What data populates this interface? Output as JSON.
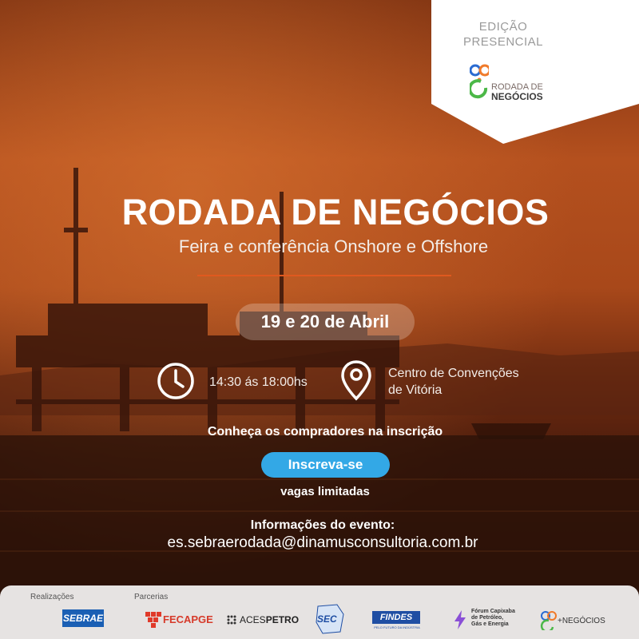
{
  "badge": {
    "line1": "EDIÇÃO",
    "line2": "PRESENCIAL",
    "logo_line1": "RODADA DE",
    "logo_line2": "NEGÓCIOS"
  },
  "hero": {
    "title": "RODADA DE NEGÓCIOS",
    "subtitle": "Feira e conferência Onshore e Offshore"
  },
  "event": {
    "date": "19 e 20 de Abril",
    "time": "14:30 ás 18:00hs",
    "place_line1": "Centro de Convenções",
    "place_line2": "de Vitória"
  },
  "cta": {
    "buyers": "Conheça os compradores na inscrição",
    "button": "Inscreva-se",
    "limited": "vagas limitadas"
  },
  "info": {
    "label": "Informações do evento:",
    "email": "es.sebraerodada@dinamusconsultoria.com.br"
  },
  "footer": {
    "realizacoes": "Realizações",
    "parcerias": "Parcerias",
    "logos": {
      "sebrae": "SEBRAE",
      "fecapge": "FECAPGE",
      "acespetro_a": "ACES",
      "acespetro_b": "PETRO",
      "sec": "SEC",
      "findes": "FINDES",
      "findes_sub": "PELO FUTURO DA INDÚSTRIA",
      "forum_1": "Fórum Capixaba",
      "forum_2": "de Petróleo,",
      "forum_3": "Gás e Energia",
      "mais_negocios": "+NEGÓCIOS"
    }
  },
  "colors": {
    "accent_orange": "#e0591f",
    "button_blue": "#33a8e6",
    "badge_bg": "#ffffff"
  }
}
